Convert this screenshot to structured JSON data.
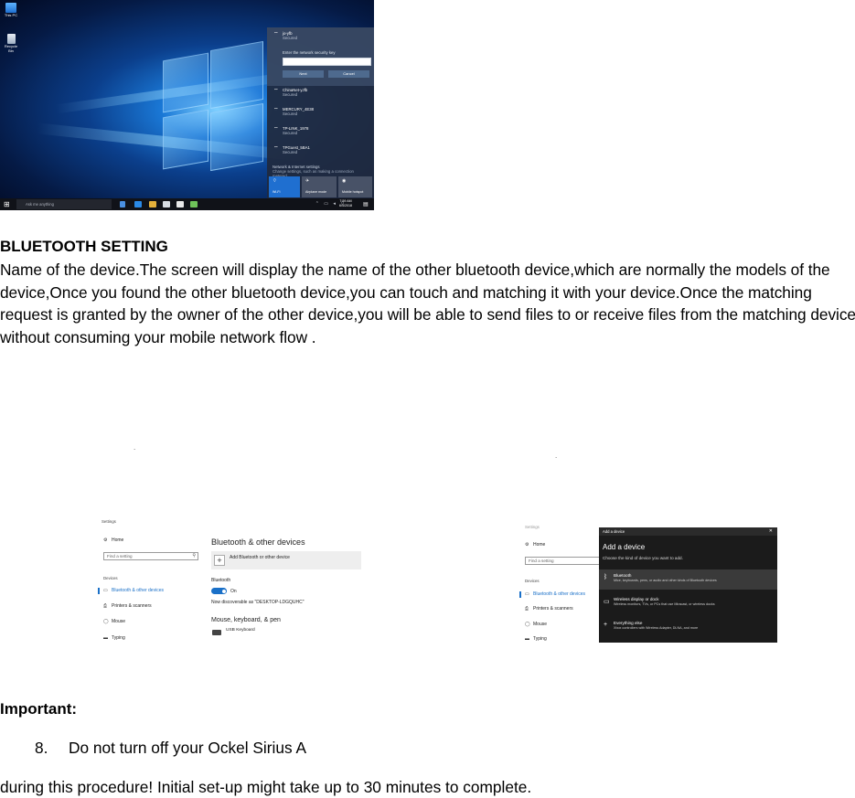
{
  "desktop": {
    "icons": [
      {
        "label": "This PC",
        "icon": "computer-icon"
      },
      {
        "label": "Recycle Bin",
        "icon": "recycle-bin-icon"
      }
    ],
    "wifi_flyout": {
      "selected_network": {
        "name": "jo-yfb",
        "status": "Secured"
      },
      "key_prompt": "Enter the network security key",
      "next_label": "Next",
      "cancel_label": "Cancel",
      "networks": [
        {
          "name": "ChinaNet-yJfb",
          "status": "Secured"
        },
        {
          "name": "MERCURY_4E38",
          "status": "Secured"
        },
        {
          "name": "TP-LINK_1978",
          "status": "Secured"
        },
        {
          "name": "TPGuest_5BA1",
          "status": "Secured"
        }
      ],
      "footer_title": "Network & Internet settings",
      "footer_sub": "Change settings, such as making a connection metered.",
      "quick_actions": [
        "Wi-Fi",
        "Airplane mode",
        "Mobile hotspot"
      ]
    },
    "taskbar": {
      "search_placeholder": "Ask me anything",
      "clock_time": "7:59 AM",
      "clock_date": "6/4/2018"
    }
  },
  "doc": {
    "section_title": "BLUETOOTH SETTING",
    "body": "Name of the device.The screen will display the name of the other bluetooth device,which are normally the models of the device,Once you found the other bluetooth device,you can touch and matching  it with your device.Once the matching request is granted by the owner of the other device,you will be able to send files to or receive files from the matching device without consuming your mobile network flow .",
    "dots": [
      ".",
      "."
    ],
    "important_title": "Important:",
    "step_number": "8.",
    "step_text": "Do not turn off your Ockel Sirius A",
    "closing_text": "during this procedure! Initial set-up might take up to 30 minutes to complete."
  },
  "settings1": {
    "window_title": "Settings",
    "home_label": "Home",
    "search_placeholder": "Find a setting",
    "category": "Devices",
    "nav": [
      "Bluetooth & other devices",
      "Printers & scanners",
      "Mouse",
      "Typing"
    ],
    "heading": "Bluetooth & other devices",
    "add_label": "Add Bluetooth or other device",
    "bt_label": "Bluetooth",
    "bt_state": "On",
    "discoverable": "Now discoverable as \"DESKTOP-LDGQUHC\"",
    "mouse_heading": "Mouse, keyboard, & pen",
    "keyboard_label": "USB Keyboard"
  },
  "settings2": {
    "window_title": "Settings",
    "home_label": "Home",
    "search_placeholder": "Find a setting",
    "category": "Devices",
    "nav": [
      "Bluetooth & other devices",
      "Printers & scanners",
      "Mouse",
      "Typing"
    ],
    "dialog": {
      "header": "Add a device",
      "title": "Add a device",
      "subtitle": "Choose the kind of device you want to add.",
      "options": [
        {
          "name": "Bluetooth",
          "desc": "Mice, keyboards, pens, or audio and other kinds of Bluetooth devices",
          "icon": "bluetooth-icon"
        },
        {
          "name": "Wireless display or dock",
          "desc": "Wireless monitors, TVs, or PCs that use Miracast, or wireless docks",
          "icon": "monitor-icon"
        },
        {
          "name": "Everything else",
          "desc": "Xbox controllers with Wireless Adapter, DLNA, and more",
          "icon": "plus-icon"
        }
      ]
    }
  }
}
